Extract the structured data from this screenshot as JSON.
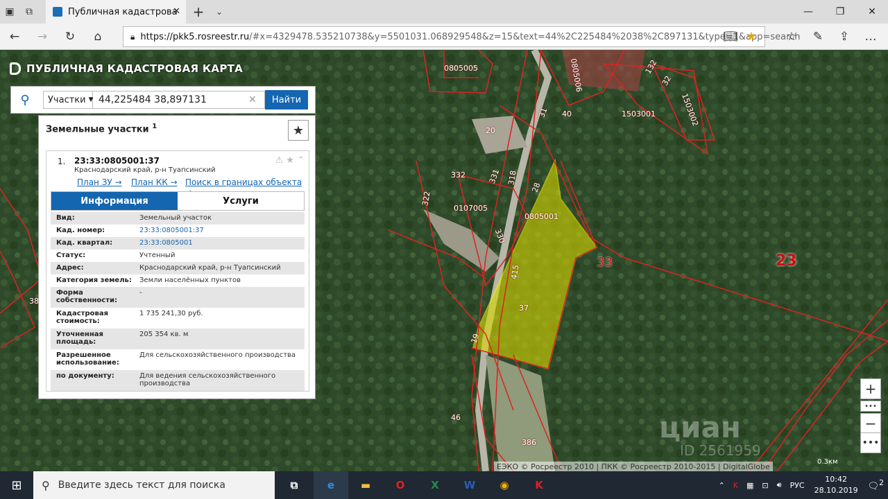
{
  "browser": {
    "tab_title": "Публичная кадастрова",
    "url_host": "https://pkk5.rosreestr.ru",
    "url_rest": "/#x=4329478.535210738&y=5501031.068929548&z=15&text=44%2C225484%2038%2C897131&type=1&app=search"
  },
  "app": {
    "title": "ПУБЛИЧНАЯ КАДАСТРОВАЯ КАРТА"
  },
  "search": {
    "type_label": "Участки",
    "query": "44,225484 38,897131",
    "button_label": "Найти"
  },
  "panel": {
    "title": "Земельные участки",
    "count": "1",
    "item_index": "1.",
    "cad_number": "23:33:0805001:37",
    "address": "Краснодарский край, р-н Туапсинский",
    "links": [
      "План ЗУ →",
      "План КК →",
      "Поиск в границах объекта →"
    ],
    "tabs": [
      "Информация",
      "Услуги"
    ],
    "rows": [
      {
        "k": "Вид:",
        "v": "Земельный участок"
      },
      {
        "k": "Кад. номер:",
        "v": "23:33:0805001:37"
      },
      {
        "k": "Кад. квартал:",
        "v": "23:33:0805001"
      },
      {
        "k": "Статус:",
        "v": "Учтенный"
      },
      {
        "k": "Адрес:",
        "v": "Краснодарский край, р-н Туапсинский"
      },
      {
        "k": "Категория земель:",
        "v": "Земли населённых пунктов"
      },
      {
        "k": "Форма собственности:",
        "v": "-"
      },
      {
        "k": "Кадастровая стоимость:",
        "v": "1 735 241,30 руб."
      },
      {
        "k": "Уточненная площадь:",
        "v": "205 354 кв. м"
      },
      {
        "k": "Разрешенное использование:",
        "v": "Для сельскохозяйственного производства"
      },
      {
        "k": "по документу:",
        "v": "Для ведения сельскохозяйственного производства"
      }
    ]
  },
  "map": {
    "labels": [
      "0805005",
      "0805006",
      "1503001",
      "1503002",
      "0107005",
      "0805001",
      "33",
      "23",
      "20",
      "332",
      "331",
      "318",
      "28",
      "40",
      "31",
      "132",
      "32",
      "37",
      "330",
      "322",
      "38",
      "46",
      "386",
      "19",
      "415"
    ],
    "attribution": "ЕЭКО © Росреестр 2010 | ПКК © Росреестр 2010-2015 | DigitalGlobe",
    "scale": "0.3км",
    "watermark": "циан",
    "watermark_id": "ID 2561959"
  },
  "taskbar": {
    "search_placeholder": "Введите здесь текст для поиска",
    "lang": "РУС",
    "time": "10:42",
    "date": "28.10.2019",
    "notif_count": "2"
  }
}
